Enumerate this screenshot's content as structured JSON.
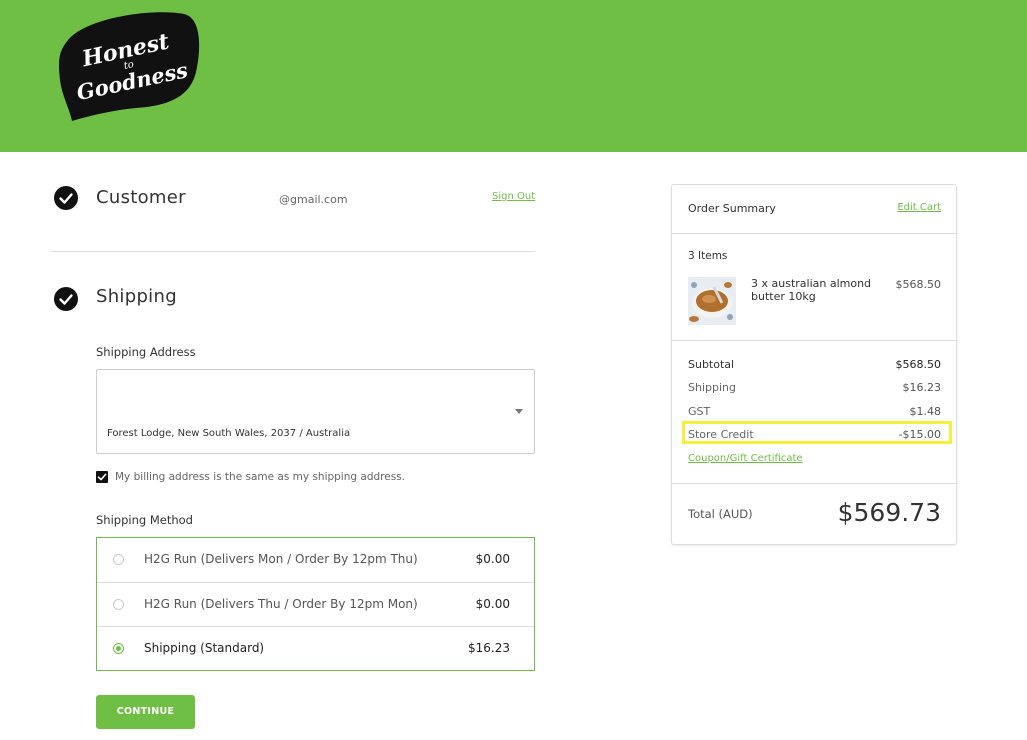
{
  "brand": {
    "logo_text": "Honest to Goodness",
    "logo_line1": "Honest",
    "logo_line2": "to",
    "logo_line3": "Goodness",
    "header_color": "#6fbf44"
  },
  "customer": {
    "title": "Customer",
    "email": "@gmail.com",
    "sign_out_label": "Sign Out"
  },
  "shipping": {
    "title": "Shipping",
    "address_label": "Shipping Address",
    "address_value": "Forest Lodge, New South Wales, 2037 / Australia",
    "billing_same_label": "My billing address is the same as my shipping address.",
    "billing_same_checked": true,
    "method_label": "Shipping Method",
    "methods": [
      {
        "name": "H2G Run (Delivers Mon / Order By 12pm Thu)",
        "price": "$0.00",
        "selected": false
      },
      {
        "name": "H2G Run (Delivers Thu / Order By 12pm Mon)",
        "price": "$0.00",
        "selected": false
      },
      {
        "name": "Shipping (Standard)",
        "price": "$16.23",
        "selected": true
      }
    ],
    "continue_label": "CONTINUE"
  },
  "order_summary": {
    "title": "Order Summary",
    "edit_cart_label": "Edit Cart",
    "items_count": "3 Items",
    "items": [
      {
        "name": "3 x australian almond butter 10kg",
        "price": "$568.50"
      }
    ],
    "subtotal_label": "Subtotal",
    "subtotal_value": "$568.50",
    "shipping_label": "Shipping",
    "shipping_value": "$16.23",
    "gst_label": "GST",
    "gst_value": "$1.48",
    "store_credit_label": "Store Credit",
    "store_credit_value": "-$15.00",
    "coupon_label": "Coupon/Gift Certificate",
    "total_label": "Total (AUD)",
    "total_value": "$569.73",
    "highlight_color": "#f7f03a"
  }
}
